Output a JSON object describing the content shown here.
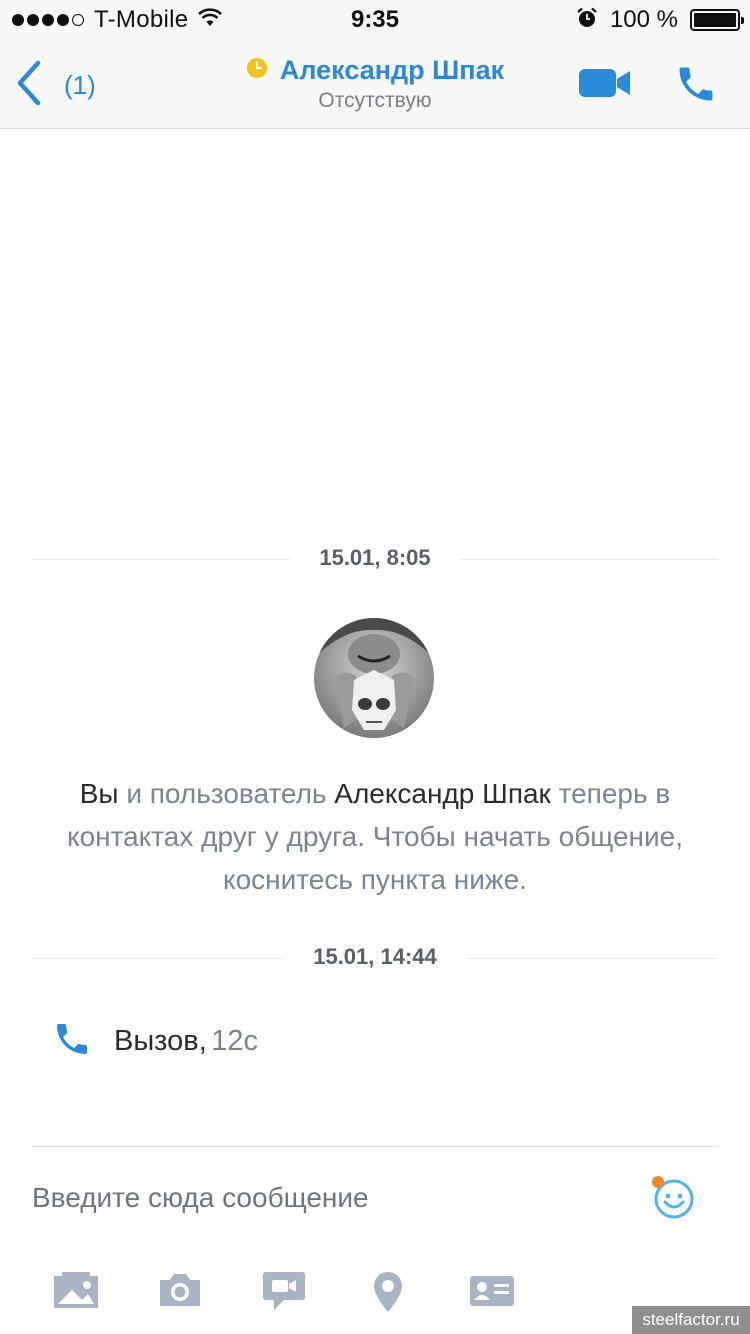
{
  "status_bar": {
    "carrier": "T-Mobile",
    "time": "9:35",
    "battery_percent": "100 %",
    "battery_level": 1.0,
    "signal_bars_filled": 4,
    "signal_bars_total": 5
  },
  "header": {
    "back_count": "(1)",
    "contact_name": "Александр Шпак",
    "status_text": "Отсутствую",
    "accent_color": "#2b8ad8",
    "status_color": "#f2c21b"
  },
  "conversation": {
    "date_1": "15.01, 8:05",
    "contact_message": {
      "you": "Вы",
      "and_user": " и пользователь ",
      "name": "Александр Шпак",
      "rest": " теперь в контактах друг у друга. Чтобы начать общение, коснитесь пункта ниже."
    },
    "date_2": "15.01, 14:44",
    "call": {
      "label": "Вызов,",
      "duration": "12с"
    }
  },
  "composer": {
    "placeholder": "Введите сюда сообщение"
  },
  "toolbar": {
    "icons": [
      "photos-icon",
      "camera-icon",
      "video-message-icon",
      "location-icon",
      "contact-card-icon"
    ]
  },
  "watermark": "steelfactor.ru"
}
